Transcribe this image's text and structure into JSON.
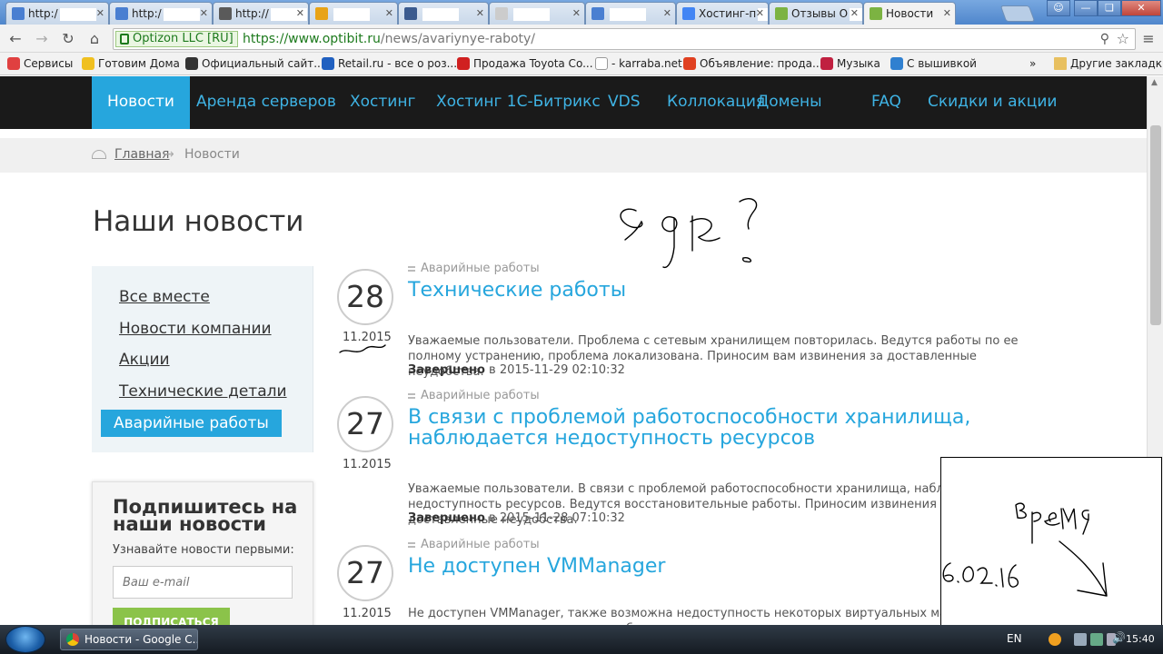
{
  "browser": {
    "tabs": [
      {
        "label": "http:/",
        "color": "#4a7fd1"
      },
      {
        "label": "http:/",
        "color": "#4a7fd1"
      },
      {
        "label": "http://",
        "color": "#5a5a5a"
      },
      {
        "label": "",
        "color": "#e8a317"
      },
      {
        "label": "",
        "color": "#3b5b8f"
      },
      {
        "label": "",
        "color": "#cccccc"
      },
      {
        "label": "",
        "color": "#4a7fd1"
      },
      {
        "label": "Хостинг-п",
        "color": "#4285f4"
      },
      {
        "label": "Отзывы О",
        "color": "#7cb342"
      },
      {
        "label": "Новости",
        "color": "#7cb342"
      }
    ],
    "ssl_label": "Optizon LLC [RU]",
    "url_host": "https://www.optibit.ru",
    "url_path": "/news/avariynye-raboty/",
    "bookmarks": [
      {
        "label": "Сервисы",
        "color": "#e04040"
      },
      {
        "label": "Готовим Дома",
        "color": "#f0c020"
      },
      {
        "label": "Официальный сайт...",
        "color": "#333333"
      },
      {
        "label": "Retail.ru - все о роз...",
        "color": "#2060c0"
      },
      {
        "label": "Продажа Toyota Co...",
        "color": "#d02020"
      },
      {
        "label": "- karraba.net",
        "color": "#ffffff"
      },
      {
        "label": "Объявление: прода...",
        "color": "#e04020"
      },
      {
        "label": "Музыка",
        "color": "#c02040"
      },
      {
        "label": "С вышивкой",
        "color": "#3080d0"
      }
    ],
    "other_bookmarks": "Другие закладки",
    "more_chevron": "»"
  },
  "site": {
    "nav": [
      {
        "label": "Новости",
        "active": true
      },
      {
        "label": "Аренда серверов",
        "active": false
      },
      {
        "label": "Хостинг",
        "active": false
      },
      {
        "label": "Хостинг 1С-Битрикс",
        "active": false
      },
      {
        "label": "VDS",
        "active": false
      },
      {
        "label": "Коллокация",
        "active": false
      },
      {
        "label": "Домены",
        "active": false
      },
      {
        "label": "FAQ",
        "active": false
      },
      {
        "label": "Скидки и акции",
        "active": false
      }
    ],
    "breadcrumb": {
      "home": "Главная",
      "arrow": "→",
      "current": "Новости"
    },
    "page_title": "Наши новости",
    "categories": [
      {
        "label": "Все вместе",
        "active": false
      },
      {
        "label": "Новости компании",
        "active": false
      },
      {
        "label": "Акции",
        "active": false
      },
      {
        "label": "Технические детали",
        "active": false
      },
      {
        "label": "Аварийные работы",
        "active": true
      }
    ],
    "subscribe": {
      "title": "Подпишитесь на наши новости",
      "description": "Узнавайте новости первыми:",
      "placeholder": "Ваш e-mail",
      "button": "ПОДПИСАТЬСЯ"
    },
    "news": [
      {
        "day": "28",
        "monthyear": "11.2015",
        "category": "Аварийные работы",
        "title": "Технические работы",
        "body": "Уважаемые пользователи. Проблема с сетевым хранилищем повторилась. Ведутся работы по ее полному устранению, проблема локализована. Приносим вам извинения за доставленные неудобства.",
        "done_label": "Завершено",
        "done_at": "в 2015-11-29 02:10:32"
      },
      {
        "day": "27",
        "monthyear": "11.2015",
        "category": "Аварийные работы",
        "title": "В связи с проблемой работоспособности хранилища, наблюдается недоступность ресурсов",
        "body": "Уважаемые пользователи. В связи с проблемой работоспособности хранилища, наблюдается недоступность ресурсов. Ведутся восстановительные работы. Приносим извинения за доставленные неудобства.",
        "done_label": "Завершено",
        "done_at": "в 2015-11-28 07:10:32"
      },
      {
        "day": "27",
        "monthyear": "11.2015",
        "category": "Аварийные работы",
        "title": "Не доступен VMManager",
        "body": "Не доступен VMManager, также возможна недоступность некоторых виртуальных машин. Приносим извинения за доставленные неудобства.",
        "done_label": "",
        "done_at": ""
      }
    ]
  },
  "taskbar": {
    "window_label": "Новости - Google C...",
    "language": "EN",
    "clock": "15:40"
  }
}
